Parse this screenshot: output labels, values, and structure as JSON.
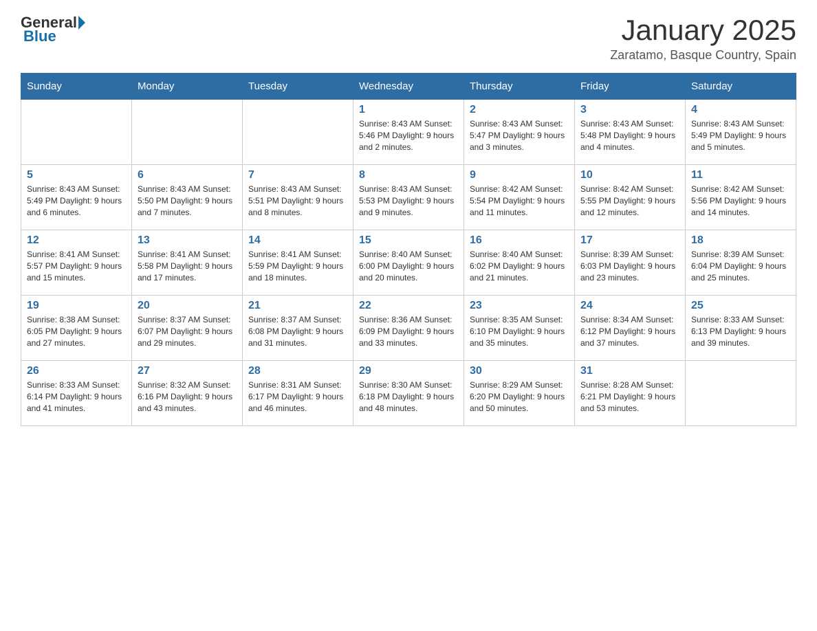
{
  "header": {
    "logo_general": "General",
    "logo_blue": "Blue",
    "title": "January 2025",
    "subtitle": "Zaratamo, Basque Country, Spain"
  },
  "columns": [
    "Sunday",
    "Monday",
    "Tuesday",
    "Wednesday",
    "Thursday",
    "Friday",
    "Saturday"
  ],
  "weeks": [
    [
      {
        "day": "",
        "info": ""
      },
      {
        "day": "",
        "info": ""
      },
      {
        "day": "",
        "info": ""
      },
      {
        "day": "1",
        "info": "Sunrise: 8:43 AM\nSunset: 5:46 PM\nDaylight: 9 hours and 2 minutes."
      },
      {
        "day": "2",
        "info": "Sunrise: 8:43 AM\nSunset: 5:47 PM\nDaylight: 9 hours and 3 minutes."
      },
      {
        "day": "3",
        "info": "Sunrise: 8:43 AM\nSunset: 5:48 PM\nDaylight: 9 hours and 4 minutes."
      },
      {
        "day": "4",
        "info": "Sunrise: 8:43 AM\nSunset: 5:49 PM\nDaylight: 9 hours and 5 minutes."
      }
    ],
    [
      {
        "day": "5",
        "info": "Sunrise: 8:43 AM\nSunset: 5:49 PM\nDaylight: 9 hours and 6 minutes."
      },
      {
        "day": "6",
        "info": "Sunrise: 8:43 AM\nSunset: 5:50 PM\nDaylight: 9 hours and 7 minutes."
      },
      {
        "day": "7",
        "info": "Sunrise: 8:43 AM\nSunset: 5:51 PM\nDaylight: 9 hours and 8 minutes."
      },
      {
        "day": "8",
        "info": "Sunrise: 8:43 AM\nSunset: 5:53 PM\nDaylight: 9 hours and 9 minutes."
      },
      {
        "day": "9",
        "info": "Sunrise: 8:42 AM\nSunset: 5:54 PM\nDaylight: 9 hours and 11 minutes."
      },
      {
        "day": "10",
        "info": "Sunrise: 8:42 AM\nSunset: 5:55 PM\nDaylight: 9 hours and 12 minutes."
      },
      {
        "day": "11",
        "info": "Sunrise: 8:42 AM\nSunset: 5:56 PM\nDaylight: 9 hours and 14 minutes."
      }
    ],
    [
      {
        "day": "12",
        "info": "Sunrise: 8:41 AM\nSunset: 5:57 PM\nDaylight: 9 hours and 15 minutes."
      },
      {
        "day": "13",
        "info": "Sunrise: 8:41 AM\nSunset: 5:58 PM\nDaylight: 9 hours and 17 minutes."
      },
      {
        "day": "14",
        "info": "Sunrise: 8:41 AM\nSunset: 5:59 PM\nDaylight: 9 hours and 18 minutes."
      },
      {
        "day": "15",
        "info": "Sunrise: 8:40 AM\nSunset: 6:00 PM\nDaylight: 9 hours and 20 minutes."
      },
      {
        "day": "16",
        "info": "Sunrise: 8:40 AM\nSunset: 6:02 PM\nDaylight: 9 hours and 21 minutes."
      },
      {
        "day": "17",
        "info": "Sunrise: 8:39 AM\nSunset: 6:03 PM\nDaylight: 9 hours and 23 minutes."
      },
      {
        "day": "18",
        "info": "Sunrise: 8:39 AM\nSunset: 6:04 PM\nDaylight: 9 hours and 25 minutes."
      }
    ],
    [
      {
        "day": "19",
        "info": "Sunrise: 8:38 AM\nSunset: 6:05 PM\nDaylight: 9 hours and 27 minutes."
      },
      {
        "day": "20",
        "info": "Sunrise: 8:37 AM\nSunset: 6:07 PM\nDaylight: 9 hours and 29 minutes."
      },
      {
        "day": "21",
        "info": "Sunrise: 8:37 AM\nSunset: 6:08 PM\nDaylight: 9 hours and 31 minutes."
      },
      {
        "day": "22",
        "info": "Sunrise: 8:36 AM\nSunset: 6:09 PM\nDaylight: 9 hours and 33 minutes."
      },
      {
        "day": "23",
        "info": "Sunrise: 8:35 AM\nSunset: 6:10 PM\nDaylight: 9 hours and 35 minutes."
      },
      {
        "day": "24",
        "info": "Sunrise: 8:34 AM\nSunset: 6:12 PM\nDaylight: 9 hours and 37 minutes."
      },
      {
        "day": "25",
        "info": "Sunrise: 8:33 AM\nSunset: 6:13 PM\nDaylight: 9 hours and 39 minutes."
      }
    ],
    [
      {
        "day": "26",
        "info": "Sunrise: 8:33 AM\nSunset: 6:14 PM\nDaylight: 9 hours and 41 minutes."
      },
      {
        "day": "27",
        "info": "Sunrise: 8:32 AM\nSunset: 6:16 PM\nDaylight: 9 hours and 43 minutes."
      },
      {
        "day": "28",
        "info": "Sunrise: 8:31 AM\nSunset: 6:17 PM\nDaylight: 9 hours and 46 minutes."
      },
      {
        "day": "29",
        "info": "Sunrise: 8:30 AM\nSunset: 6:18 PM\nDaylight: 9 hours and 48 minutes."
      },
      {
        "day": "30",
        "info": "Sunrise: 8:29 AM\nSunset: 6:20 PM\nDaylight: 9 hours and 50 minutes."
      },
      {
        "day": "31",
        "info": "Sunrise: 8:28 AM\nSunset: 6:21 PM\nDaylight: 9 hours and 53 minutes."
      },
      {
        "day": "",
        "info": ""
      }
    ]
  ]
}
